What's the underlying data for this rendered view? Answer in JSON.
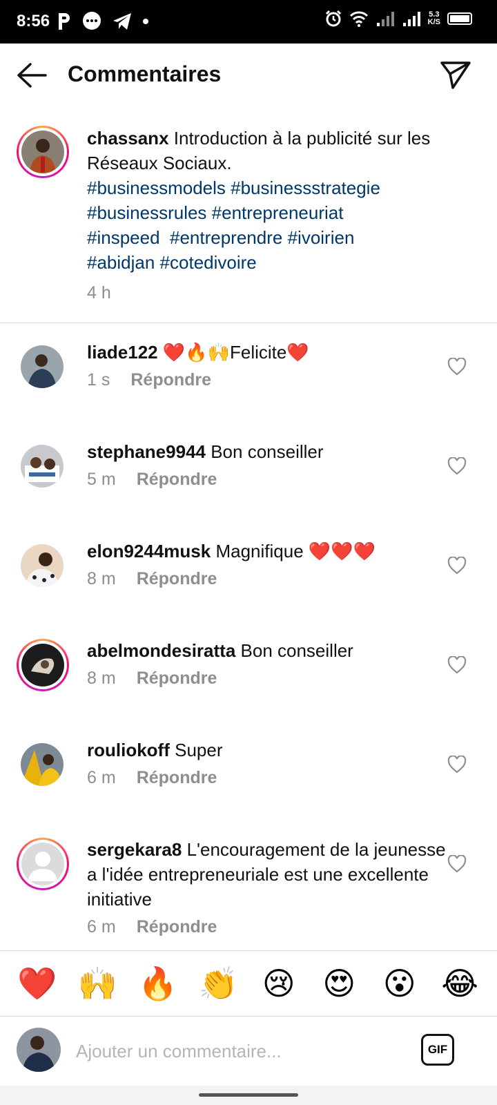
{
  "status_bar": {
    "time": "8:56",
    "net_speed_top": "5.3",
    "net_speed_bottom": "K/S",
    "icons": [
      "p-app-icon",
      "chat-bubble-icon",
      "telegram-icon",
      "dot-icon",
      "alarm-icon",
      "wifi-icon",
      "signal-icon",
      "battery-icon"
    ]
  },
  "header": {
    "title": "Commentaires"
  },
  "caption": {
    "username": "chassanx",
    "text": "Introduction à la publicité sur les Réseaux Sociaux.",
    "hashtags": [
      "#businessmodels",
      "#businessstrategie",
      "#businessrules",
      "#entrepreneuriat",
      "#inspeed",
      "#entreprendre",
      "#ivoirien",
      "#abidjan",
      "#cotedivoire"
    ],
    "time": "4 h"
  },
  "comments": [
    {
      "username": "liade122",
      "text": "❤️🔥🙌Felicite❤️",
      "time": "1 s",
      "reply": "Répondre"
    },
    {
      "username": "stephane9944",
      "text": "Bon conseiller",
      "time": "5 m",
      "reply": "Répondre"
    },
    {
      "username": "elon9244musk",
      "text": "Magnifique ❤️❤️❤️",
      "time": "8 m",
      "reply": "Répondre"
    },
    {
      "username": "abelmondesiratta",
      "text": "Bon conseiller",
      "time": "8 m",
      "reply": "Répondre"
    },
    {
      "username": "rouliokoff",
      "text": "Super",
      "time": "6 m",
      "reply": "Répondre"
    },
    {
      "username": "sergekara8",
      "text": "L'encouragement de la jeunesse a l'idée entrepreneuriale est une excellente initiative",
      "time": "6 m",
      "reply": "Répondre"
    }
  ],
  "emoji_bar": [
    "❤️",
    "🙌",
    "🔥",
    "👏",
    "😢",
    "😍",
    "😮",
    "😂"
  ],
  "input": {
    "placeholder": "Ajouter un commentaire...",
    "gif_label": "GIF"
  },
  "colors": {
    "hashtag": "#00376b",
    "meta_gray": "#8e8e8e",
    "story_ring_start": "#fbaa47",
    "story_ring_end": "#c81cc0"
  }
}
